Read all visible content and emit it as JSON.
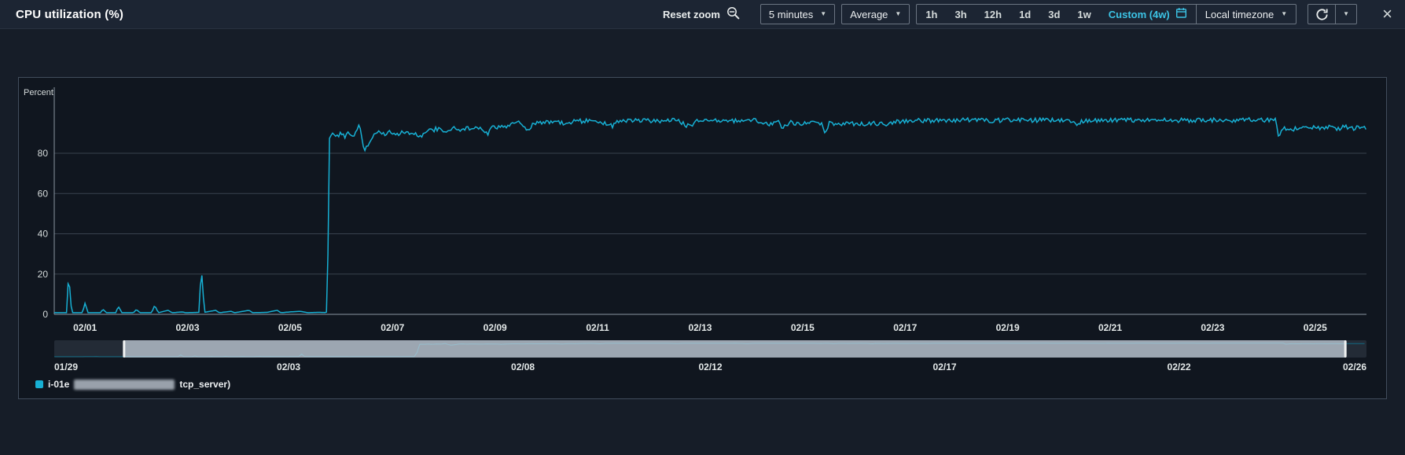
{
  "colors": {
    "accent": "#3cc4e6",
    "line": "#17b0d4",
    "grid": "#39424e",
    "axis": "#8a95a1",
    "tick_text": "#d5dbdb",
    "brush_track": "#333d4a",
    "brush_selection": "#b6c0ca",
    "brush_handle": "#f1f3f3",
    "panel_bg": "#10161f"
  },
  "header": {
    "title": "CPU utilization (%)",
    "reset_zoom_label": "Reset zoom",
    "period_select": "5 minutes",
    "statistic_select": "Average",
    "ranges": [
      "1h",
      "3h",
      "12h",
      "1d",
      "3d",
      "1w"
    ],
    "custom_range_label": "Custom (4w)",
    "timezone_select": "Local timezone"
  },
  "legend": {
    "prefix": "i-01e",
    "suffix": "tcp_server)"
  },
  "chart_data": {
    "type": "line",
    "title": "CPU utilization (%)",
    "ylabel": "Percent",
    "unit_label": "Percent",
    "ylim": [
      0,
      100
    ],
    "y_ticks": [
      0,
      20,
      40,
      60,
      80
    ],
    "grid": true,
    "legend_position": "bottom-left",
    "period": "5 minutes",
    "statistic": "Average",
    "main_domain_days": [
      2.4,
      28
    ],
    "brush_domain_days": [
      0,
      28
    ],
    "brush_selection_days": [
      1.49,
      27.55
    ],
    "main_x_ticks": [
      {
        "label": "02/01",
        "day": 3
      },
      {
        "label": "02/03",
        "day": 5
      },
      {
        "label": "02/05",
        "day": 7
      },
      {
        "label": "02/07",
        "day": 9
      },
      {
        "label": "02/09",
        "day": 11
      },
      {
        "label": "02/11",
        "day": 13
      },
      {
        "label": "02/13",
        "day": 15
      },
      {
        "label": "02/15",
        "day": 17
      },
      {
        "label": "02/17",
        "day": 19
      },
      {
        "label": "02/19",
        "day": 21
      },
      {
        "label": "02/21",
        "day": 23
      },
      {
        "label": "02/23",
        "day": 25
      },
      {
        "label": "02/25",
        "day": 27
      }
    ],
    "brush_x_ticks": [
      {
        "label": "01/29",
        "day": 0
      },
      {
        "label": "02/03",
        "day": 5
      },
      {
        "label": "02/08",
        "day": 10
      },
      {
        "label": "02/12",
        "day": 14
      },
      {
        "label": "02/17",
        "day": 19
      },
      {
        "label": "02/22",
        "day": 24
      },
      {
        "label": "02/26",
        "day": 28
      }
    ],
    "noise": {
      "from": 7.78,
      "to": 28,
      "amp": 1.1
    },
    "series": [
      {
        "name": "i-01e[redacted]tcp_server)",
        "color": "#17b0d4",
        "points": [
          [
            0,
            0.8
          ],
          [
            0.6,
            0.8
          ],
          [
            0.9,
            2
          ],
          [
            0.96,
            0.8
          ],
          [
            1.5,
            0.8
          ],
          [
            1.55,
            3
          ],
          [
            1.62,
            0.8
          ],
          [
            2.1,
            0.8
          ],
          [
            2.4,
            0.8
          ],
          [
            2.64,
            0.8
          ],
          [
            2.68,
            20
          ],
          [
            2.74,
            0.8
          ],
          [
            2.95,
            0.8
          ],
          [
            3.0,
            5.5
          ],
          [
            3.06,
            0.8
          ],
          [
            3.3,
            0.8
          ],
          [
            3.35,
            2.5
          ],
          [
            3.42,
            0.8
          ],
          [
            3.6,
            0.8
          ],
          [
            3.65,
            4
          ],
          [
            3.72,
            0.8
          ],
          [
            3.95,
            0.8
          ],
          [
            4.0,
            2.5
          ],
          [
            4.07,
            0.8
          ],
          [
            4.3,
            0.8
          ],
          [
            4.36,
            4.5
          ],
          [
            4.43,
            0.8
          ],
          [
            4.62,
            2
          ],
          [
            4.7,
            0.8
          ],
          [
            4.9,
            1.2
          ],
          [
            4.97,
            0.8
          ],
          [
            5.22,
            1
          ],
          [
            5.27,
            23
          ],
          [
            5.33,
            1
          ],
          [
            5.55,
            2
          ],
          [
            5.62,
            0.8
          ],
          [
            5.85,
            1.5
          ],
          [
            5.92,
            0.8
          ],
          [
            6.2,
            2
          ],
          [
            6.27,
            0.8
          ],
          [
            6.55,
            1
          ],
          [
            6.75,
            2
          ],
          [
            6.82,
            0.8
          ],
          [
            7.0,
            1.2
          ],
          [
            7.2,
            1.5
          ],
          [
            7.35,
            0.8
          ],
          [
            7.55,
            1
          ],
          [
            7.68,
            0.9
          ],
          [
            7.73,
            1.2
          ],
          [
            7.76,
            87
          ],
          [
            7.82,
            89.5
          ],
          [
            7.9,
            87.5
          ],
          [
            7.98,
            90
          ],
          [
            8.06,
            88
          ],
          [
            8.15,
            90.5
          ],
          [
            8.25,
            89
          ],
          [
            8.32,
            91
          ],
          [
            8.35,
            96
          ],
          [
            8.42,
            84
          ],
          [
            8.47,
            82
          ],
          [
            8.55,
            85
          ],
          [
            8.62,
            89.5
          ],
          [
            8.7,
            91
          ],
          [
            8.8,
            89.5
          ],
          [
            8.95,
            90.5
          ],
          [
            9.1,
            89
          ],
          [
            9.25,
            91
          ],
          [
            9.4,
            90
          ],
          [
            9.55,
            88.5
          ],
          [
            9.7,
            91
          ],
          [
            9.85,
            92
          ],
          [
            10.0,
            91
          ],
          [
            10.15,
            92.5
          ],
          [
            10.3,
            91.5
          ],
          [
            10.5,
            92.5
          ],
          [
            10.7,
            93
          ],
          [
            10.85,
            89.5
          ],
          [
            10.95,
            93
          ],
          [
            11.1,
            92.5
          ],
          [
            11.3,
            94.5
          ],
          [
            11.5,
            95
          ],
          [
            11.65,
            91.5
          ],
          [
            11.75,
            95
          ],
          [
            12.0,
            95.5
          ],
          [
            12.3,
            95
          ],
          [
            12.6,
            96
          ],
          [
            13.0,
            96
          ],
          [
            13.3,
            93.5
          ],
          [
            13.42,
            96
          ],
          [
            13.8,
            96.3
          ],
          [
            14.2,
            96
          ],
          [
            14.55,
            96.5
          ],
          [
            14.8,
            93
          ],
          [
            14.92,
            96
          ],
          [
            15.3,
            96.3
          ],
          [
            15.7,
            96
          ],
          [
            16.1,
            96.4
          ],
          [
            16.35,
            94
          ],
          [
            16.5,
            96.2
          ],
          [
            16.62,
            92.5
          ],
          [
            16.75,
            95.5
          ],
          [
            16.95,
            94.3
          ],
          [
            17.15,
            95.5
          ],
          [
            17.38,
            95
          ],
          [
            17.43,
            90
          ],
          [
            17.52,
            95
          ],
          [
            17.7,
            94
          ],
          [
            17.9,
            95.2
          ],
          [
            18.1,
            94.3
          ],
          [
            18.35,
            95
          ],
          [
            18.6,
            94.2
          ],
          [
            18.8,
            95.5
          ],
          [
            19.0,
            96
          ],
          [
            19.4,
            96.3
          ],
          [
            19.8,
            96
          ],
          [
            20.2,
            96.5
          ],
          [
            20.6,
            96.2
          ],
          [
            21.0,
            96.5
          ],
          [
            21.4,
            96.3
          ],
          [
            21.8,
            96.5
          ],
          [
            22.1,
            96.2
          ],
          [
            22.35,
            94.8
          ],
          [
            22.5,
            96.4
          ],
          [
            22.9,
            96.3
          ],
          [
            23.3,
            96.5
          ],
          [
            23.7,
            96.2
          ],
          [
            24.1,
            96.5
          ],
          [
            24.5,
            96.3
          ],
          [
            24.9,
            96.5
          ],
          [
            25.3,
            96.4
          ],
          [
            25.7,
            96.5
          ],
          [
            26.0,
            96.4
          ],
          [
            26.22,
            96.5
          ],
          [
            26.28,
            89
          ],
          [
            26.38,
            92.5
          ],
          [
            26.55,
            91.5
          ],
          [
            26.7,
            93.2
          ],
          [
            26.85,
            91.8
          ],
          [
            27.0,
            93
          ],
          [
            27.15,
            92
          ],
          [
            27.3,
            93.5
          ],
          [
            27.45,
            92.2
          ],
          [
            27.6,
            93.2
          ],
          [
            27.75,
            92.4
          ],
          [
            27.9,
            93
          ],
          [
            28,
            92.5
          ]
        ]
      }
    ]
  }
}
